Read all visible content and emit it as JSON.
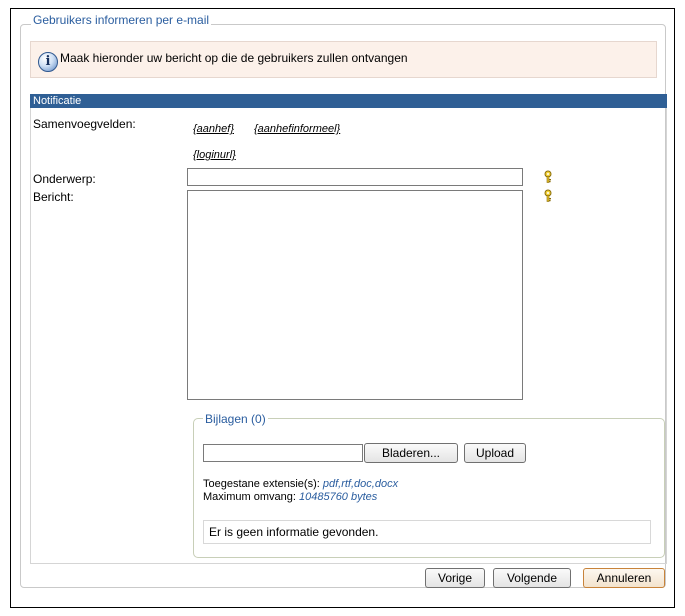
{
  "page": {
    "title": "Gebruikers informeren per e-mail",
    "info_message": "Maak hieronder uw bericht op die de gebruikers zullen ontvangen"
  },
  "section": {
    "header": "Notificatie",
    "merge_fields_label": "Samenvoegvelden:",
    "merge_fields": [
      "{aanhef}",
      "{aanhefinformeel}",
      "{loginurl}"
    ],
    "subject_label": "Onderwerp:",
    "subject_value": "",
    "message_label": "Bericht:",
    "message_value": ""
  },
  "attachments": {
    "legend": "Bijlagen (0)",
    "browse_label": "Bladeren...",
    "upload_label": "Upload",
    "allowed_label": "Toegestane extensie(s): ",
    "allowed_value": "pdf,rtf,doc,docx",
    "max_label": "Maximum omvang: ",
    "max_value": "10485760 bytes",
    "empty_message": "Er is geen informatie gevonden."
  },
  "footer": {
    "prev_label": "Vorige",
    "next_label": "Volgende",
    "cancel_label": "Annuleren"
  },
  "icons": {
    "info": "info-icon",
    "key": "key-icon"
  },
  "colors": {
    "header_bg": "#2f5f95",
    "legend_text": "#2a5d9f",
    "info_bg": "#fcf1ea"
  }
}
